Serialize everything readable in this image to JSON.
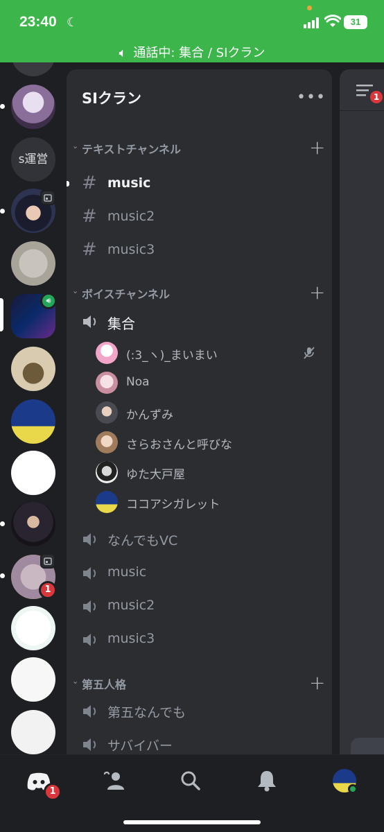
{
  "status_bar": {
    "time": "23:40",
    "battery": "31",
    "call_status": "通話中: 集合 / SIクラン"
  },
  "servers": [
    {
      "name": "s運営",
      "type": "text"
    }
  ],
  "server": {
    "name": "SIクラン"
  },
  "categories": [
    {
      "label": "テキストチャンネル"
    },
    {
      "label": "ボイスチャンネル"
    },
    {
      "label": "第五人格"
    }
  ],
  "text_channels": [
    {
      "name": "music",
      "unread": true
    },
    {
      "name": "music2"
    },
    {
      "name": "music3"
    }
  ],
  "voice_channels": [
    {
      "name": "集合",
      "connected": true
    },
    {
      "name": "なんでもVC"
    },
    {
      "name": "music"
    },
    {
      "name": "music2"
    },
    {
      "name": "music3"
    }
  ],
  "voice_members": [
    {
      "name": "(:3_ヽ)_まいまい",
      "muted": true
    },
    {
      "name": "Noa"
    },
    {
      "name": "かんずみ"
    },
    {
      "name": "さらおさんと呼びな"
    },
    {
      "name": "ゆた大戸屋"
    },
    {
      "name": "ココアシガレット"
    }
  ],
  "dai5_channels": [
    {
      "name": "第五なんでも"
    },
    {
      "name": "サバイバー"
    }
  ],
  "badges": {
    "server_notification": "1",
    "home_notification": "1",
    "right_panel": "1"
  },
  "nav": [
    "home",
    "friends",
    "search",
    "notifications",
    "profile"
  ],
  "colors": {
    "status_bar": "#3cb54a",
    "background": "#1e1f22",
    "panel": "#2b2d31",
    "mention": "#da373c",
    "online": "#23a55a"
  }
}
